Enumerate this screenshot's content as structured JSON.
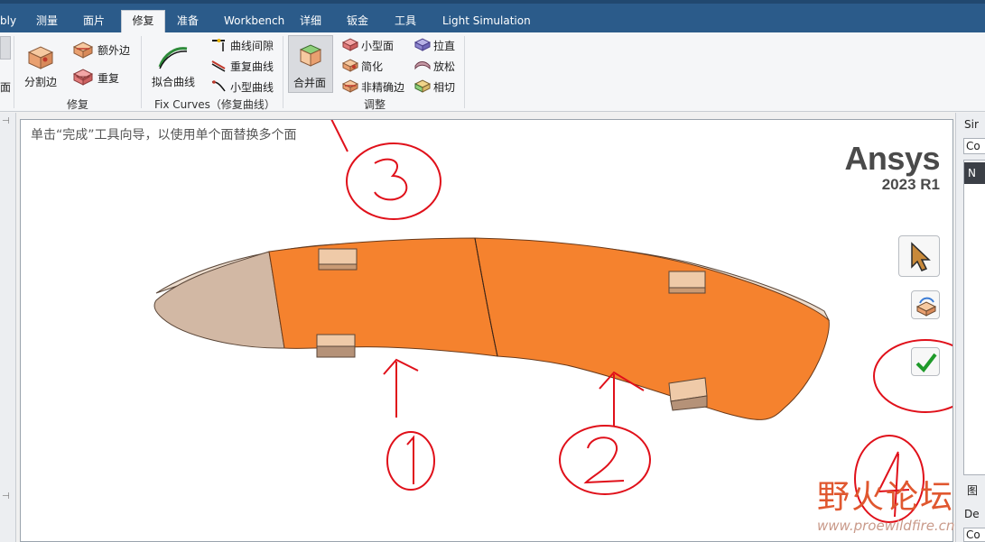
{
  "menu": {
    "tabs": [
      {
        "label": "bly"
      },
      {
        "label": "测量"
      },
      {
        "label": "面片"
      },
      {
        "label": "修复"
      },
      {
        "label": "准备"
      },
      {
        "label": "Workbench"
      },
      {
        "label": "详细"
      },
      {
        "label": "钣金"
      },
      {
        "label": "工具"
      },
      {
        "label": "Light Simulation"
      }
    ],
    "active_tab": "修复"
  },
  "ribbon": {
    "left_cut_label": "面",
    "repair_group": {
      "split_edge": "分割边",
      "extra_edge": "额外边",
      "duplicate": "重复",
      "label": "修复"
    },
    "fix_curves_group": {
      "fit_curve": "拟合曲线",
      "curve_gap": "曲线间隙",
      "duplicate_curve": "重复曲线",
      "small_curve": "小型曲线",
      "label": "Fix Curves（修复曲线）"
    },
    "adjust_group": {
      "merge_faces": "合并面",
      "small_face": "小型面",
      "simplify": "简化",
      "inexact_edge": "非精确边",
      "straighten": "拉直",
      "relax": "放松",
      "tangent": "相切",
      "label": "调整"
    }
  },
  "viewport": {
    "hint": "单击“完成”工具向导，以使用单个面替换多个面",
    "brand_name": "Ansys",
    "brand_version": "2023 R1",
    "tools": {
      "select": "cursor-arrow-icon",
      "select_faces": "select-faces-icon",
      "complete": "checkmark-icon"
    },
    "annotations": [
      "1",
      "2",
      "3",
      "4"
    ]
  },
  "right_panel": {
    "title_cut": "Sir",
    "combo_cut": "Co",
    "list_cut": "N",
    "lower_cut": "图",
    "lower_cut2": "De",
    "lower_combo": "Co"
  },
  "watermark": {
    "title": "野火论坛",
    "url": "www.proewildfire.cn"
  },
  "colors": {
    "menubar": "#2b5b8a",
    "selected_face": "#f5822e",
    "base_face": "#d2b8a4",
    "annotation_ink": "#e0101a"
  }
}
